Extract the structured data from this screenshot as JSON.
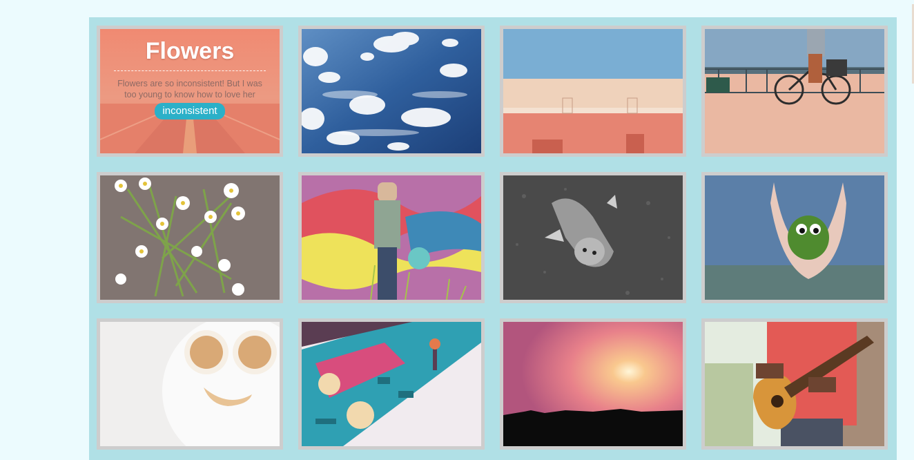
{
  "feature": {
    "title": "Flowers",
    "description": "Flowers are so inconsistent! But I was too young to know how to love her",
    "tag": "inconsistent"
  },
  "tiles": [
    {
      "subject": "desert road at sunset (flowers card)"
    },
    {
      "subject": "blue sky with clouds"
    },
    {
      "subject": "salmon and beige wall under blue sky"
    },
    {
      "subject": "cyclist on a boardwalk"
    },
    {
      "subject": "white daisies on gravel"
    },
    {
      "subject": "person leaning on graffiti wall"
    },
    {
      "subject": "black and white cat on asphalt"
    },
    {
      "subject": "hands holding moss creature with googly eyes"
    },
    {
      "subject": "pancake smiley face breakfast"
    },
    {
      "subject": "retro arcade machine buttons"
    },
    {
      "subject": "sunset over city skyline"
    },
    {
      "subject": "man playing acoustic guitar"
    }
  ],
  "colors": {
    "page_background": "#ecfbfe",
    "grid_background": "#b0e0e6",
    "tile_frame": "#cdcdcd",
    "tag_background": "#2bb0c8"
  }
}
